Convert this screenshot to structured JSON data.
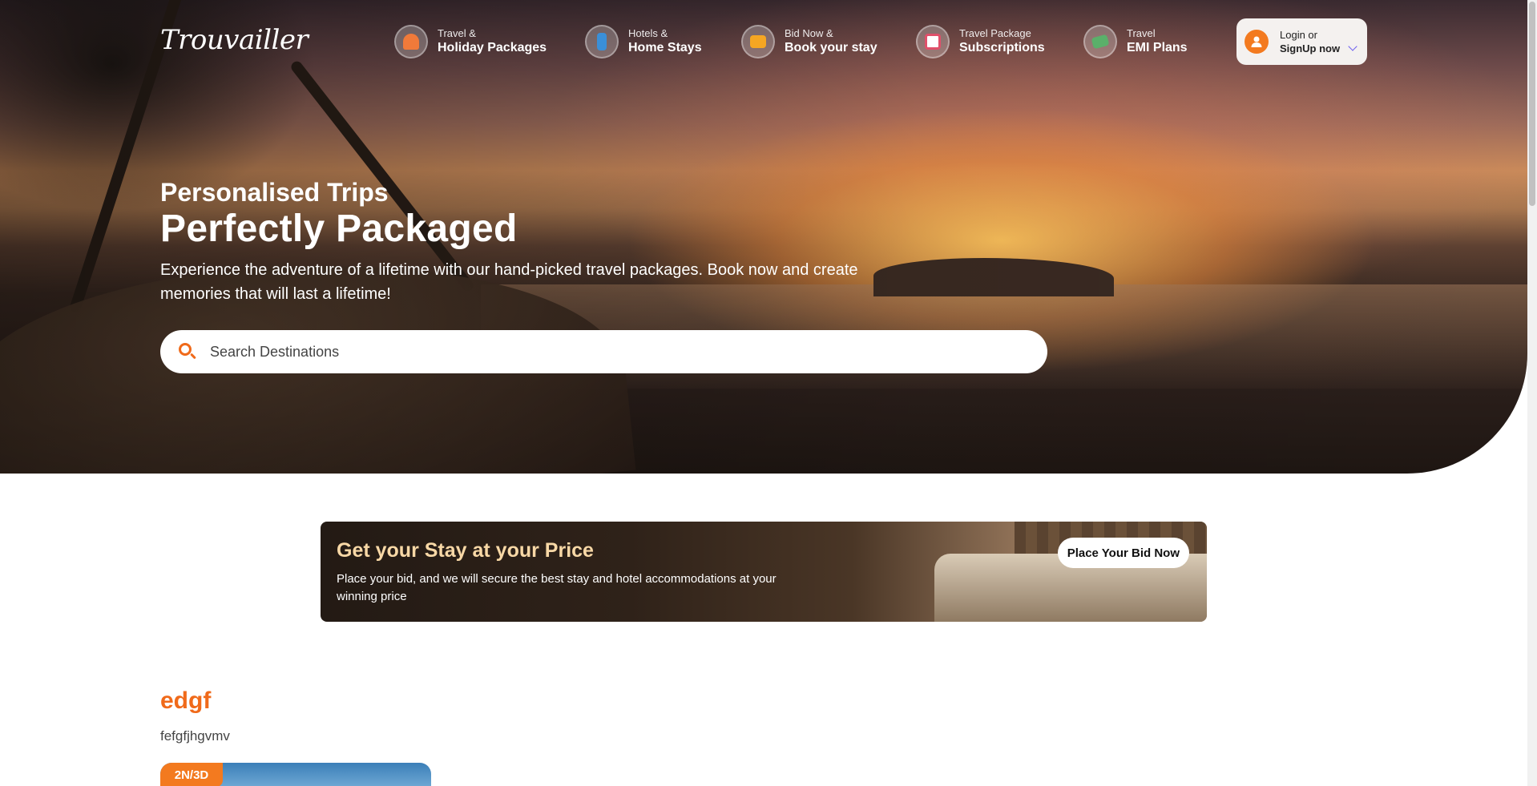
{
  "brand": {
    "logo": "Trouvailler"
  },
  "nav": {
    "items": [
      {
        "small": "Travel &",
        "big": "Holiday Packages",
        "icon": "beach-umbrella-icon",
        "color": "#f07a3a"
      },
      {
        "small": "Hotels &",
        "big": "Home Stays",
        "icon": "hotel-building-icon",
        "color": "#3a8fd8"
      },
      {
        "small": "Bid Now &",
        "big": "Book your stay",
        "icon": "wallet-icon",
        "color": "#f5a623"
      },
      {
        "small": "Travel Package",
        "big": "Subscriptions",
        "icon": "calendar-icon",
        "color": "#e0506a"
      },
      {
        "small": "Travel",
        "big": "EMI Plans",
        "icon": "laptop-payment-icon",
        "color": "#5ab06a"
      }
    ],
    "login": {
      "line1": "Login or",
      "line2": "SignUp now"
    }
  },
  "hero": {
    "subtitle": "Personalised Trips",
    "title": "Perfectly Packaged",
    "description": "Experience the adventure of a lifetime with our hand-picked travel packages. Book now and create memories that will last a lifetime!",
    "search": {
      "placeholder": "Search Destinations",
      "value": ""
    }
  },
  "bid_banner": {
    "title": "Get your Stay at your Price",
    "description": "Place your bid, and we will secure the best stay and hotel accommodations at your winning price",
    "button": "Place Your Bid Now"
  },
  "section": {
    "title": "edgf",
    "subtitle": "fefgfjhgvmv",
    "cards": [
      {
        "badge": "2N/3D"
      }
    ]
  },
  "colors": {
    "accent": "#f06a1a",
    "bid_title": "#f8d8a6"
  }
}
